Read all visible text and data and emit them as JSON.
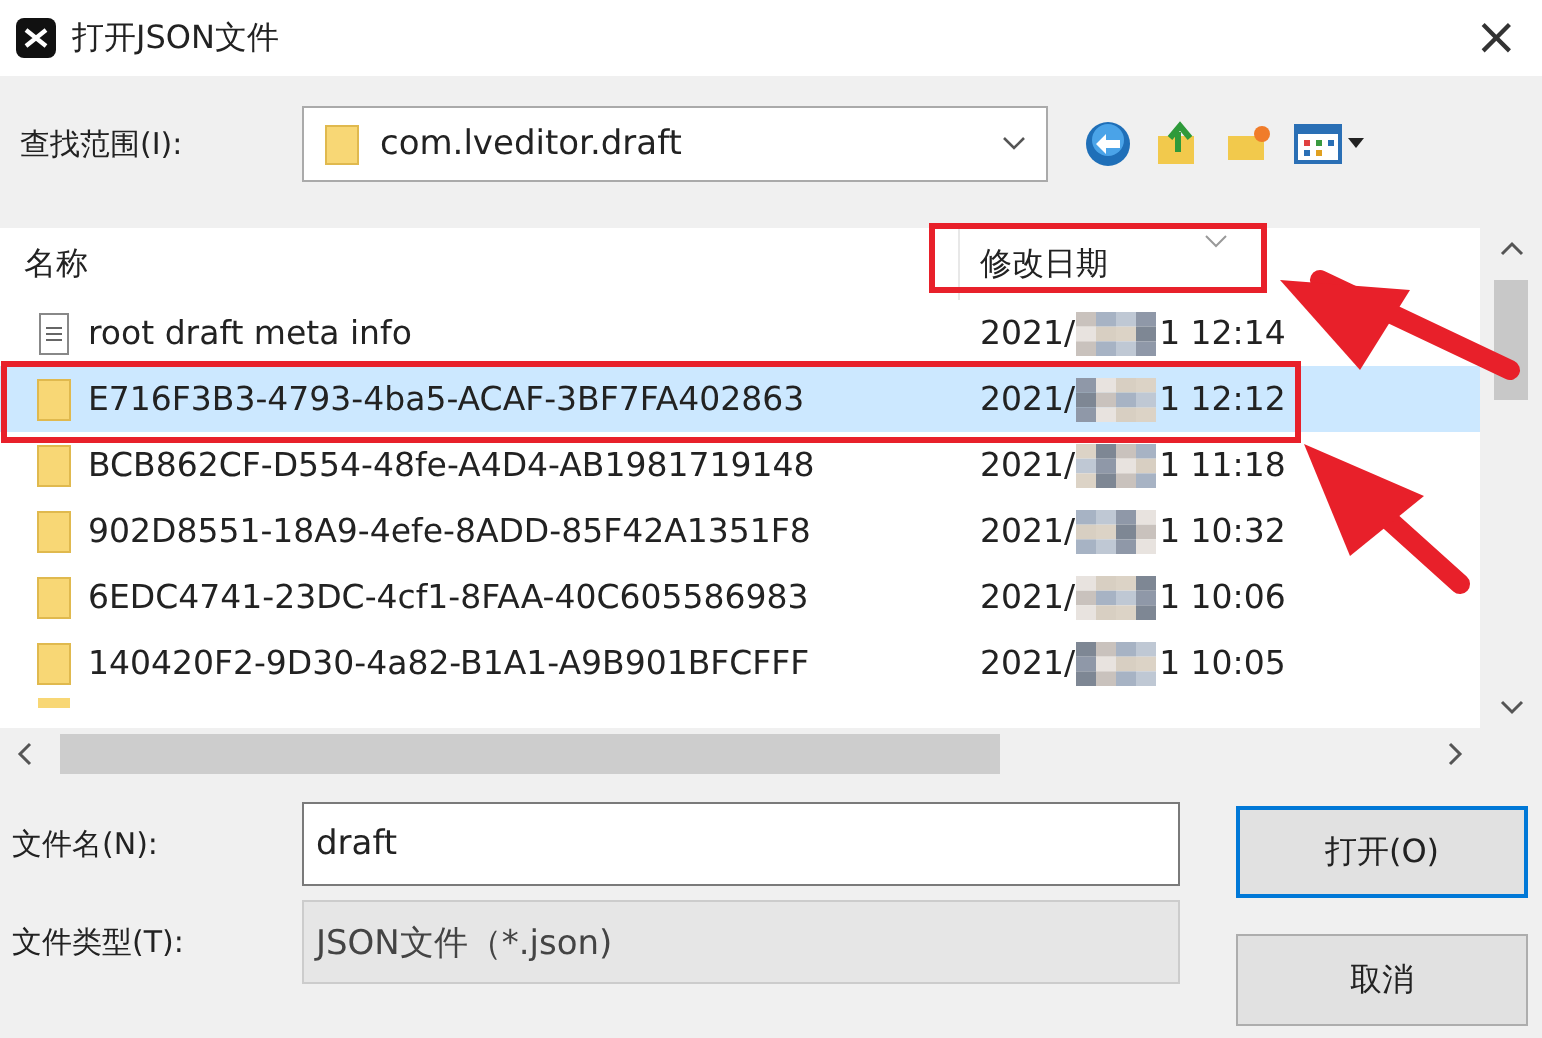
{
  "window": {
    "title": "打开JSON文件",
    "close": "×"
  },
  "location": {
    "label": "查找范围(I):",
    "value": "com.lveditor.draft"
  },
  "columns": [
    {
      "label": "名称",
      "sorted": false
    },
    {
      "label": "修改日期",
      "sorted": true
    }
  ],
  "rows": [
    {
      "kind": "file",
      "name": "root draft meta info",
      "date_start": "2021/",
      "date_end": "1 12:14",
      "selected": false
    },
    {
      "kind": "folder",
      "name": "E716F3B3-4793-4ba5-ACAF-3BF7FA402863",
      "date_start": "2021/",
      "date_end": "1 12:12",
      "selected": true
    },
    {
      "kind": "folder",
      "name": "BCB862CF-D554-48fe-A4D4-AB1981719148",
      "date_start": "2021/",
      "date_end": "1 11:18",
      "selected": false
    },
    {
      "kind": "folder",
      "name": "902D8551-18A9-4efe-8ADD-85F42A1351F8",
      "date_start": "2021/",
      "date_end": "1 10:32",
      "selected": false
    },
    {
      "kind": "folder",
      "name": "6EDC4741-23DC-4cf1-8FAA-40C605586983",
      "date_start": "2021/",
      "date_end": "1 10:06",
      "selected": false
    },
    {
      "kind": "folder",
      "name": "140420F2-9D30-4a82-B1A1-A9B901BFCFFF",
      "date_start": "2021/",
      "date_end": "1 10:05",
      "selected": false
    }
  ],
  "filename": {
    "label": "文件名(N):",
    "value": "draft"
  },
  "filetype": {
    "label": "文件类型(T):",
    "value": "JSON文件（*.json)"
  },
  "buttons": [
    {
      "label": "打开(O)",
      "default": true
    },
    {
      "label": "取消",
      "default": false
    }
  ]
}
